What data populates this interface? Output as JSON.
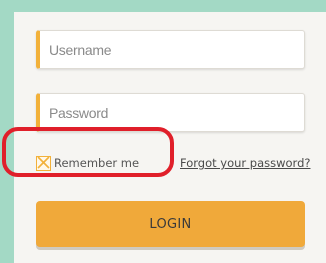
{
  "login_form": {
    "username_placeholder": "Username",
    "password_placeholder": "Password",
    "remember_label": "Remember me",
    "forgot_link": "Forgot your password?",
    "login_button": "LOGIN"
  },
  "colors": {
    "background": "#a3d9c5",
    "card": "#f6f5f2",
    "accent": "#f0a93a",
    "highlight": "#e01f2a"
  },
  "icons": {
    "checkbox": "checkbox-checked-x-icon"
  }
}
